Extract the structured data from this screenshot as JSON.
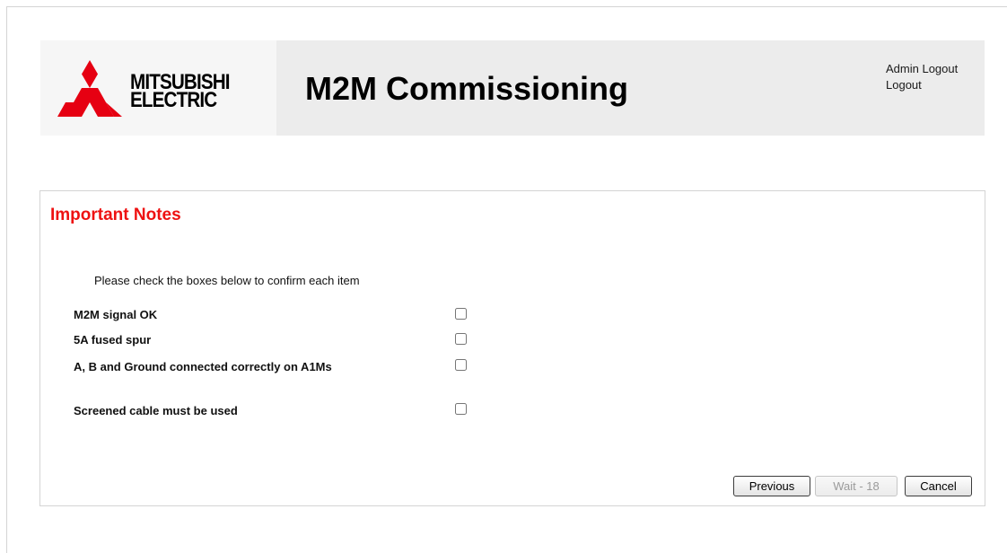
{
  "header": {
    "brand_line1": "MITSUBISHI",
    "brand_line2": "ELECTRIC",
    "brand_color": "#e60012",
    "title": "M2M Commissioning",
    "links": [
      "Admin Logout",
      "Logout"
    ]
  },
  "notes": {
    "title": "Important Notes",
    "title_color": "#ee1111",
    "instructions": "Please check the boxes below to confirm each item",
    "items": [
      {
        "label": "M2M signal OK",
        "checked": false
      },
      {
        "label": "5A fused spur",
        "checked": false
      },
      {
        "label": "A, B and Ground connected correctly on A1Ms",
        "checked": false
      },
      {
        "label": "Screened cable must be used",
        "checked": false
      }
    ]
  },
  "buttons": {
    "previous": "Previous",
    "wait": "Wait - 18",
    "cancel": "Cancel"
  }
}
